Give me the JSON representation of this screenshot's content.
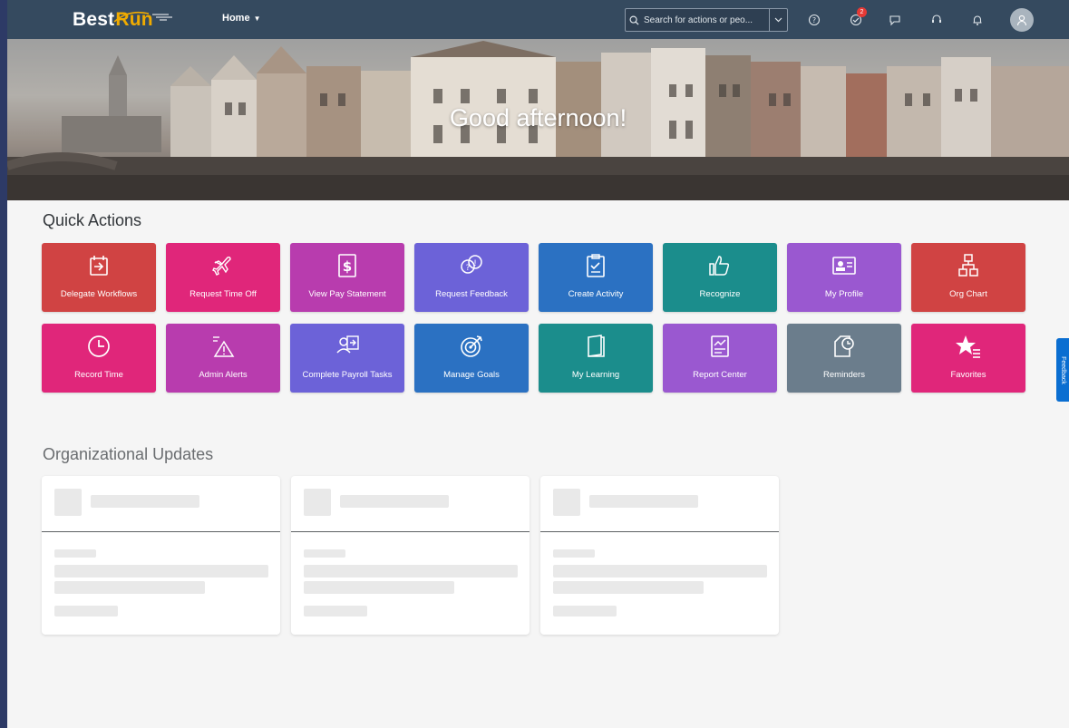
{
  "shell": {
    "logo_text_1": "Best",
    "logo_text_2": "Run",
    "home_label": "Home",
    "search_placeholder": "Search for actions or peo...",
    "notification_count": "2",
    "icons": [
      "help-icon",
      "todo-icon",
      "feedback-icon",
      "support-icon",
      "bell-icon",
      "user-icon"
    ]
  },
  "hero": {
    "greeting": "Good afternoon!"
  },
  "quick_actions": {
    "title": "Quick Actions",
    "tiles": [
      {
        "label": "Delegate Workflows",
        "icon": "delegate-icon",
        "color": "#d04343"
      },
      {
        "label": "Request Time Off",
        "icon": "plane-icon",
        "color": "#e0267a"
      },
      {
        "label": "View Pay Statement",
        "icon": "dollar-doc-icon",
        "color": "#b83cae"
      },
      {
        "label": "Request Feedback",
        "icon": "feedback-request-icon",
        "color": "#6c62d8"
      },
      {
        "label": "Create Activity",
        "icon": "clipboard-icon",
        "color": "#2b71c2"
      },
      {
        "label": "Recognize",
        "icon": "thumbs-up-icon",
        "color": "#1b8d8c"
      },
      {
        "label": "My Profile",
        "icon": "profile-card-icon",
        "color": "#9a58d0"
      },
      {
        "label": "Org Chart",
        "icon": "org-chart-icon",
        "color": "#d04343"
      },
      {
        "label": "Record Time",
        "icon": "clock-icon",
        "color": "#e0267a"
      },
      {
        "label": "Admin Alerts",
        "icon": "alert-icon",
        "color": "#b83cae"
      },
      {
        "label": "Complete Payroll Tasks",
        "icon": "payroll-icon",
        "color": "#6c62d8"
      },
      {
        "label": "Manage Goals",
        "icon": "target-icon",
        "color": "#2b71c2"
      },
      {
        "label": "My Learning",
        "icon": "book-icon",
        "color": "#1b8d8c"
      },
      {
        "label": "Report Center",
        "icon": "report-icon",
        "color": "#9a58d0"
      },
      {
        "label": "Reminders",
        "icon": "reminder-icon",
        "color": "#6b7d8c"
      },
      {
        "label": "Favorites",
        "icon": "star-icon",
        "color": "#e0267a"
      }
    ]
  },
  "side_tab": {
    "label": "Feedback"
  },
  "org_updates": {
    "title": "Organizational Updates"
  }
}
